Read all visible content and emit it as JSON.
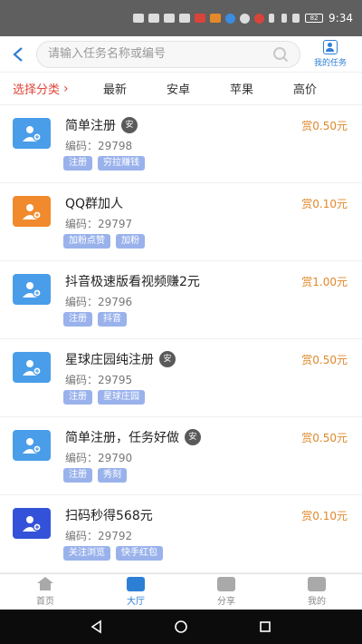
{
  "status": {
    "time": "9:34",
    "battery": "82"
  },
  "header": {
    "search_placeholder": "请输入任务名称或编号",
    "my_tasks_label": "我的任务"
  },
  "filters": {
    "category_label": "选择分类",
    "tabs": [
      "最新",
      "安卓",
      "苹果",
      "高价"
    ]
  },
  "tasks": [
    {
      "title": "简单注册",
      "badge": "安",
      "code": "编码：29798",
      "tags": [
        "注册",
        "穷拉赚钱"
      ],
      "reward": "赏0.50元",
      "icon_color": "blue"
    },
    {
      "title": "QQ群加人",
      "badge": "",
      "code": "编码：29797",
      "tags": [
        "加粉点赞",
        "加粉"
      ],
      "reward": "赏0.10元",
      "icon_color": "orange"
    },
    {
      "title": "抖音极速版看视频赚2元",
      "badge": "",
      "code": "编码：29796",
      "tags": [
        "注册",
        "抖音"
      ],
      "reward": "赏1.00元",
      "icon_color": "blue"
    },
    {
      "title": "星球庄园纯注册",
      "badge": "安",
      "code": "编码：29795",
      "tags": [
        "注册",
        "星球庄园"
      ],
      "reward": "赏0.50元",
      "icon_color": "blue"
    },
    {
      "title": "简单注册，任务好做",
      "badge": "安",
      "code": "编码：29790",
      "tags": [
        "注册",
        "秀刻"
      ],
      "reward": "赏0.50元",
      "icon_color": "blue"
    },
    {
      "title": "扫码秒得568元",
      "badge": "",
      "code": "编码：29792",
      "tags": [
        "关注浏览",
        "快手红包"
      ],
      "reward": "赏0.10元",
      "icon_color": "navy"
    }
  ],
  "bottom_nav": [
    {
      "label": "首页",
      "active": false
    },
    {
      "label": "大厅",
      "active": true
    },
    {
      "label": "分享",
      "active": false
    },
    {
      "label": "我的",
      "active": false
    }
  ],
  "colors": {
    "accent": "#2d7fd6",
    "reward": "#e0882a",
    "category": "#e0443a",
    "tag": "#9ab2ec"
  }
}
